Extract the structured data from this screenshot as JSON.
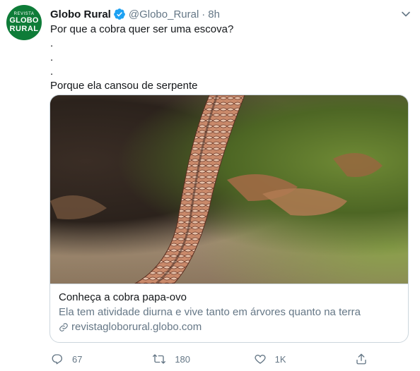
{
  "account": {
    "avatar_line1": "REVISTA",
    "avatar_line2": "GLOBO",
    "avatar_line3": "RURAL",
    "name": "Globo Rural",
    "handle": "@Globo_Rural",
    "separator": "·",
    "time": "8h"
  },
  "tweet": {
    "lines": [
      "Por que a cobra quer ser uma escova?",
      ".",
      ".",
      ".",
      "Porque ela cansou de serpente"
    ]
  },
  "card": {
    "title": "Conheça a cobra papa-ovo",
    "description": "Ela tem atividade diurna e vive tanto em árvores quanto na terra",
    "domain": "revistagloborural.globo.com"
  },
  "actions": {
    "replies": "67",
    "retweets": "180",
    "likes": "1K"
  },
  "colors": {
    "accent": "#1da1f2",
    "muted": "#657786",
    "border": "#ccd6dd",
    "avatar_bg": "#0e7c38"
  }
}
